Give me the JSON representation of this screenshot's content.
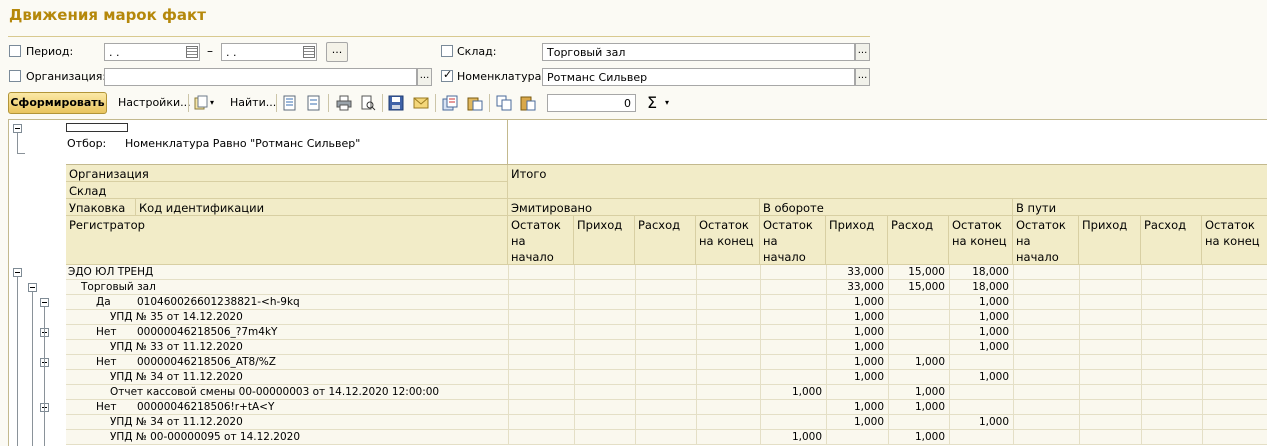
{
  "title": "Движения марок факт",
  "filters": {
    "period_label": "Период:",
    "period_from": " .  .",
    "period_to": " .  .",
    "period_dash": "–",
    "period_btn": "...",
    "organization_label": "Организация:",
    "organization_value": "",
    "warehouse_label": "Склад:",
    "warehouse_value": "Торговый зал",
    "nomenclature_label": "Номенклатура:",
    "nomenclature_value": "Ротманс Сильвер",
    "ellipsis": "..."
  },
  "toolbar": {
    "form_button": "Сформировать",
    "settings": "Настройки...",
    "find": "Найти...",
    "sum_value": "0",
    "sigma": "Σ",
    "dropdown": "▾"
  },
  "report": {
    "filter_label": "Отбор:",
    "filter_value": "Номенклатура Равно \"Ротманс Сильвер\"",
    "headers": {
      "organization": "Организация",
      "warehouse": "Склад",
      "package": "Упаковка",
      "code": "Код идентификации",
      "registrar": "Регистратор",
      "total": "Итого",
      "emitted": "Эмитировано",
      "in_turnover": "В обороте",
      "in_transit": "В пути",
      "start_balance": "Остаток на начало",
      "income": "Приход",
      "expense": "Расход",
      "end_balance": "Остаток на конец"
    },
    "rows": [
      {
        "text": "ЭДО ЮЛ ТРЕНД",
        "indent": 0,
        "text2": "",
        "v": [
          "",
          "",
          "",
          "",
          "",
          "33,000",
          "15,000",
          "18,000",
          "",
          "",
          "",
          ""
        ]
      },
      {
        "text": "Торговый зал",
        "indent": 1,
        "text2": "",
        "v": [
          "",
          "",
          "",
          "",
          "",
          "33,000",
          "15,000",
          "18,000",
          "",
          "",
          "",
          ""
        ]
      },
      {
        "text": "Да",
        "indent": 2,
        "text2": "010460026601238821-<h-9kq",
        "v": [
          "",
          "",
          "",
          "",
          "",
          "1,000",
          "",
          "1,000",
          "",
          "",
          "",
          ""
        ]
      },
      {
        "text": "УПД № 35 от 14.12.2020",
        "indent": 3,
        "text2": "",
        "v": [
          "",
          "",
          "",
          "",
          "",
          "1,000",
          "",
          "1,000",
          "",
          "",
          "",
          ""
        ]
      },
      {
        "text": "Нет",
        "indent": 2,
        "text2": "00000046218506_?7m4kY",
        "v": [
          "",
          "",
          "",
          "",
          "",
          "1,000",
          "",
          "1,000",
          "",
          "",
          "",
          ""
        ]
      },
      {
        "text": "УПД № 33 от 11.12.2020",
        "indent": 3,
        "text2": "",
        "v": [
          "",
          "",
          "",
          "",
          "",
          "1,000",
          "",
          "1,000",
          "",
          "",
          "",
          ""
        ]
      },
      {
        "text": "Нет",
        "indent": 2,
        "text2": "00000046218506_AT8/%Z",
        "v": [
          "",
          "",
          "",
          "",
          "",
          "1,000",
          "1,000",
          "",
          "",
          "",
          "",
          ""
        ]
      },
      {
        "text": "УПД № 34 от 11.12.2020",
        "indent": 3,
        "text2": "",
        "v": [
          "",
          "",
          "",
          "",
          "",
          "1,000",
          "",
          "1,000",
          "",
          "",
          "",
          ""
        ]
      },
      {
        "text": "Отчет кассовой смены 00-00000003 от 14.12.2020 12:00:00",
        "indent": 3,
        "text2": "",
        "v": [
          "",
          "",
          "",
          "",
          "1,000",
          "",
          "1,000",
          "",
          "",
          "",
          "",
          ""
        ]
      },
      {
        "text": "Нет",
        "indent": 2,
        "text2": "00000046218506!r+tA<Y",
        "v": [
          "",
          "",
          "",
          "",
          "",
          "1,000",
          "1,000",
          "",
          "",
          "",
          "",
          ""
        ]
      },
      {
        "text": "УПД № 34 от 11.12.2020",
        "indent": 3,
        "text2": "",
        "v": [
          "",
          "",
          "",
          "",
          "",
          "1,000",
          "",
          "1,000",
          "",
          "",
          "",
          ""
        ]
      },
      {
        "text": "УПД № 00-00000095 от 14.12.2020",
        "indent": 3,
        "text2": "",
        "v": [
          "",
          "",
          "",
          "",
          "1,000",
          "",
          "1,000",
          "",
          "",
          "",
          "",
          ""
        ]
      }
    ]
  }
}
